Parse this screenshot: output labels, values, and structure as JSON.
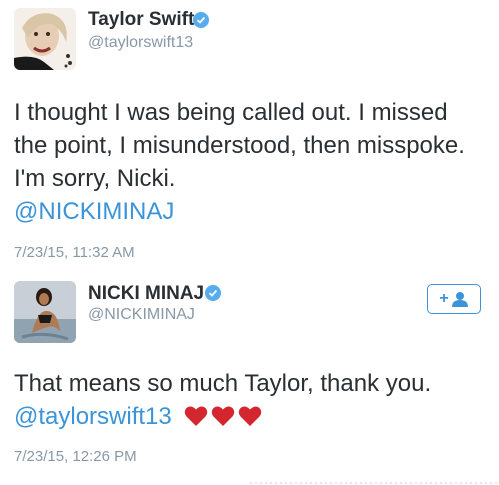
{
  "tweets": [
    {
      "display_name": "Taylor Swift",
      "handle": "@taylorswift13",
      "text_lines": [
        "I thought I was being called out. I missed",
        "the point, I misunderstood, then misspoke.",
        "I'm sorry, Nicki."
      ],
      "mention": "@NICKIMINAJ",
      "timestamp": "7/23/15, 11:32 AM",
      "verified_icon": "verified-badge-icon"
    },
    {
      "display_name": "NICKI MINAJ",
      "handle": "@NICKIMINAJ",
      "text_lines": [
        "That means so much Taylor, thank you."
      ],
      "mention": "@taylorswift13",
      "hearts": [
        "red-heart-icon",
        "red-heart-icon",
        "red-heart-icon"
      ],
      "timestamp": "7/23/15, 12:26 PM",
      "verified_icon": "verified-badge-icon",
      "follow_button_icon": "follow-user-icon"
    }
  ],
  "colors": {
    "link": "#3b94d9",
    "verified": "#55acee",
    "meta": "#8899a6",
    "text": "#292f33",
    "heart": "#d4262f"
  }
}
